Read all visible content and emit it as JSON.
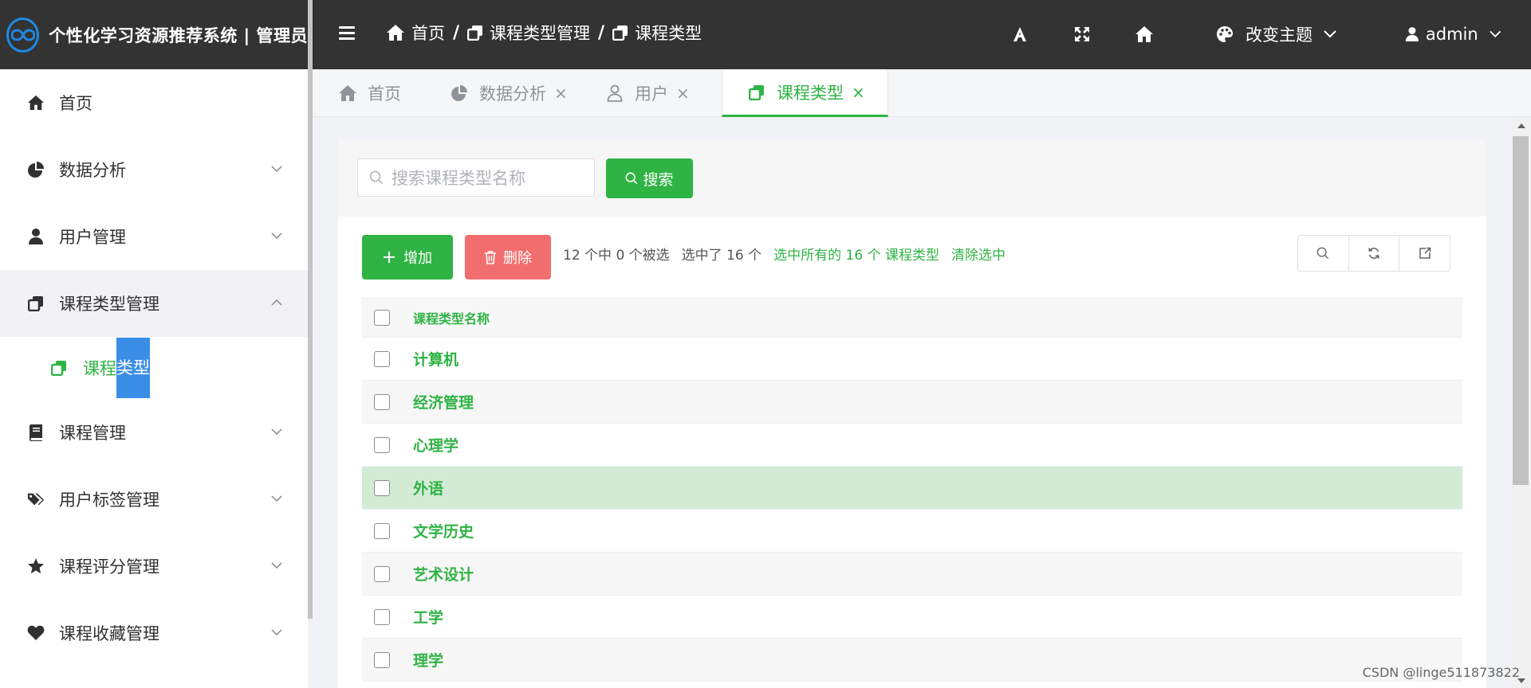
{
  "header": {
    "brand_title": "个性化学习资源推荐系统 | 管理员",
    "breadcrumb": [
      "首页",
      "课程类型管理",
      "课程类型"
    ],
    "theme_label": "改变主题",
    "user_label": "admin"
  },
  "sidebar": {
    "items": [
      {
        "label": "首页",
        "icon": "home-icon"
      },
      {
        "label": "数据分析",
        "icon": "pie-chart-icon"
      },
      {
        "label": "用户管理",
        "icon": "user-icon"
      },
      {
        "label": "课程类型管理",
        "icon": "copy-icon"
      },
      {
        "label": "课程管理",
        "icon": "book-icon"
      },
      {
        "label": "用户标签管理",
        "icon": "tags-icon"
      },
      {
        "label": "课程评分管理",
        "icon": "star-icon"
      },
      {
        "label": "课程收藏管理",
        "icon": "heart-icon"
      }
    ],
    "sub_item": {
      "label_a": "课程",
      "label_b": "类型"
    }
  },
  "tabs": [
    {
      "label": "首页",
      "icon": "home-icon",
      "closable": false
    },
    {
      "label": "数据分析",
      "icon": "pie-chart-icon",
      "closable": true
    },
    {
      "label": "用户",
      "icon": "user-icon",
      "closable": true
    },
    {
      "label": "课程类型",
      "icon": "copy-icon",
      "closable": true,
      "active": true
    }
  ],
  "search": {
    "placeholder": "搜索课程类型名称",
    "button_label": "搜索"
  },
  "toolbar": {
    "add_label": "增加",
    "delete_label": "删除",
    "count_text": "12 个中 0 个被选",
    "selected_text": "选中了 16 个",
    "select_all_text": "选中所有的 16 个 课程类型",
    "clear_text": "清除选中"
  },
  "table": {
    "header": "课程类型名称",
    "rows": [
      "计算机",
      "经济管理",
      "心理学",
      "外语",
      "文学历史",
      "艺术设计",
      "工学",
      "理学"
    ]
  },
  "watermark": "CSDN @linge511873822",
  "colors": {
    "accent": "#2fb344",
    "danger": "#f26e6e",
    "header_bg": "#333333"
  }
}
